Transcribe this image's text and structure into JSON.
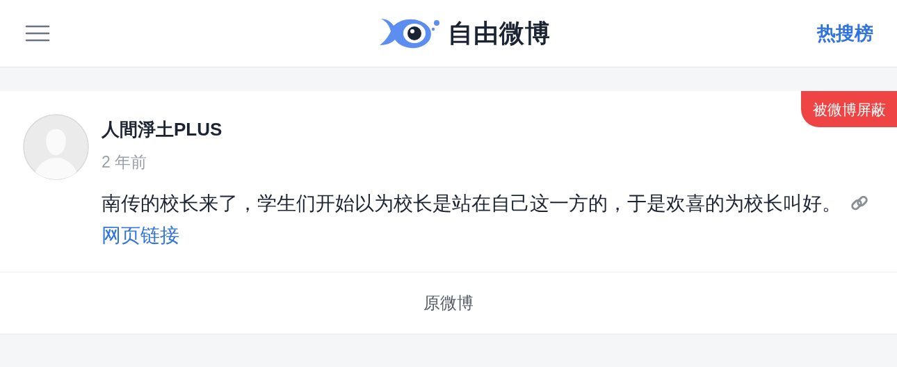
{
  "header": {
    "logo_text": "自由微博",
    "hot_link": "热搜榜"
  },
  "post": {
    "author": "人間淨土PLUS",
    "time": "2 年前",
    "badge": "被微博屏蔽",
    "text": "南传的校长来了，学生们开始以为校长是站在自己这一方的，于是欢喜的为校长叫好。",
    "link_text": "网页链接"
  },
  "footer": {
    "original_link": "原微博"
  }
}
